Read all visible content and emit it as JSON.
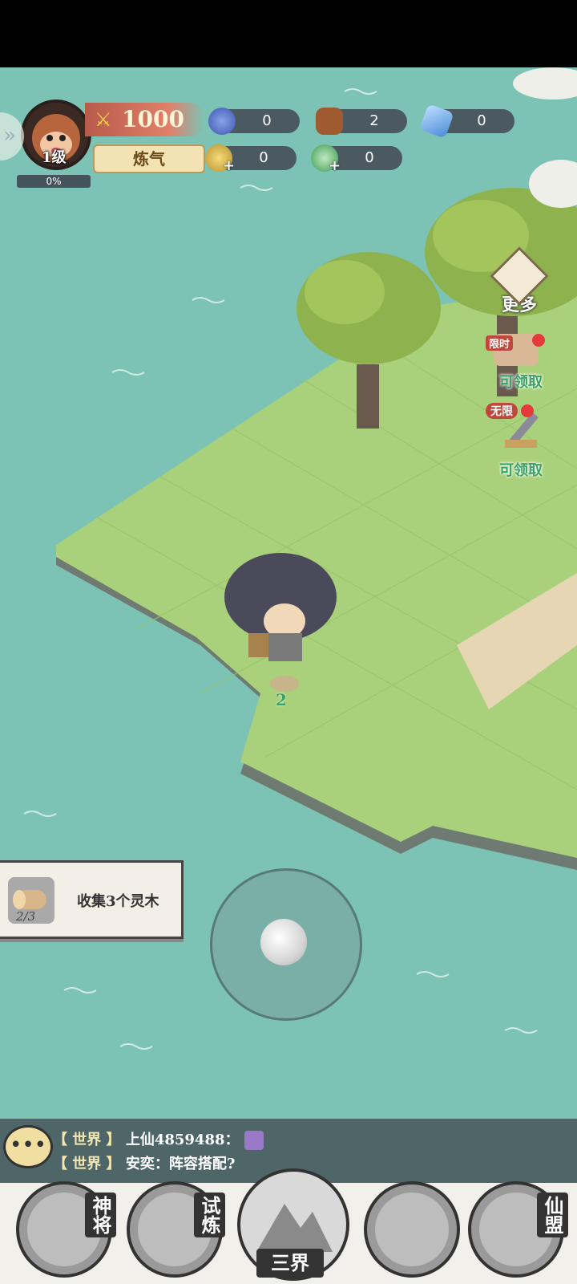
{
  "player": {
    "level": "1级",
    "exp_percent": "0%",
    "power": "1000",
    "realm": "炼气"
  },
  "resources": [
    {
      "name": "spirit-orb",
      "value": "0"
    },
    {
      "name": "wood-log",
      "value": "2"
    },
    {
      "name": "blue-crystal",
      "value": "0"
    },
    {
      "name": "gold-coin",
      "value": "0"
    },
    {
      "name": "jade-ring",
      "value": "0"
    }
  ],
  "side": {
    "more": "更多",
    "limited_tag": "限时",
    "limited_claim": "可领取",
    "infinite_tag": "无限",
    "infinite_claim": "可领取"
  },
  "world": {
    "pickup_count": "2"
  },
  "quest": {
    "progress": "2/3",
    "text": "收集3个灵木"
  },
  "chat": {
    "line1_channel": "【 世界 】",
    "line1_text": "上仙4859488：",
    "line2_channel": "【 世界 】",
    "line2_text": "安奕：阵容搭配?"
  },
  "nav": {
    "generals": "神将",
    "trial": "试炼",
    "three_realms": "三界",
    "chest": "",
    "alliance": "仙盟"
  }
}
